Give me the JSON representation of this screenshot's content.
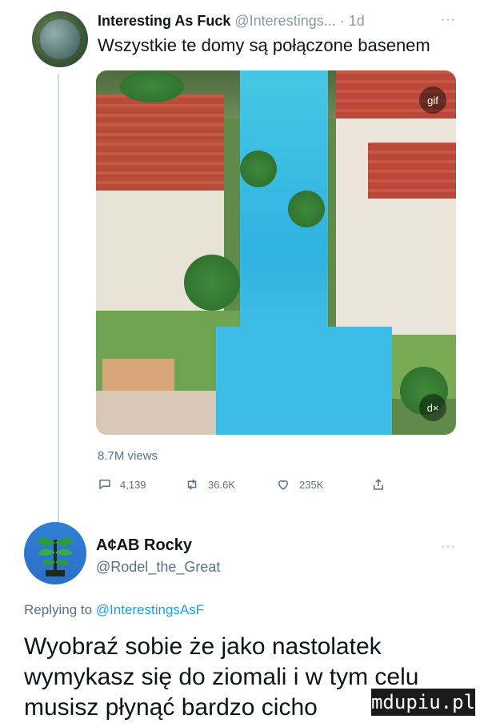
{
  "tweet": {
    "author_name": "Interesting As Fuck",
    "author_handle": "@Interestings...",
    "separator": "·",
    "time": "1d",
    "more": "···",
    "text": "Wszystkie te domy są połączone basenem",
    "media_badge_left": "gif",
    "media_badge_right": "d×",
    "views": "8.7M views",
    "stats": {
      "replies": "4,139",
      "retweets": "36.6K",
      "likes": "235K"
    }
  },
  "reply": {
    "author_name": "A¢AB Rocky",
    "author_handle": "@Rodel_the_Great",
    "more": "···",
    "replying_prefix": "Replying to",
    "replying_to": "@InterestingsAsF",
    "lines": [
      "Wyobraź sobie że jako nastolatek",
      "wymykasz się do ziomali i w tym celu",
      "musisz płynąć bardzo cicho"
    ]
  },
  "watermark": "mdupiu.pl",
  "colors": {
    "accent": "#1d9bf0",
    "muted": "#5b7083",
    "text": "#0f1419"
  }
}
